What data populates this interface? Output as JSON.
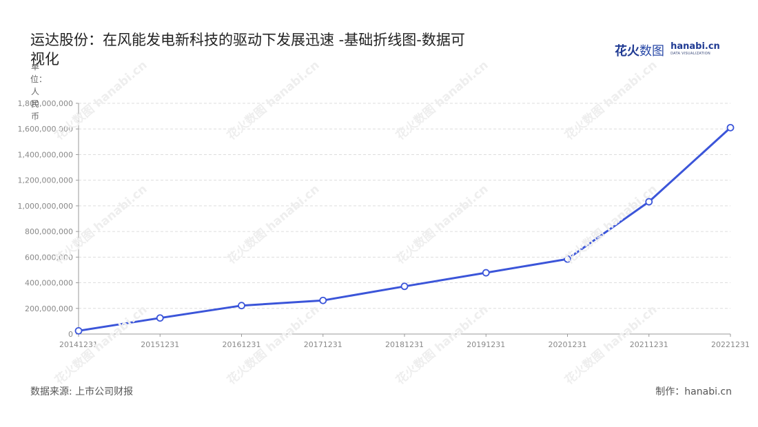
{
  "header": {
    "title_line1": "运达股份：在风能发电新科技的驱动下发展迅速  -基础折线图-数据可",
    "title_line2": "视化",
    "logo_cn_bold": "花火",
    "logo_cn_light": "数图",
    "logo_en": "hanabi.cn",
    "logo_sub": "DATA VISUALIZATION"
  },
  "yaxis_unit": "单位：人民币",
  "footer": {
    "source": "数据来源: 上市公司财报",
    "credit": "制作：hanabi.cn"
  },
  "colors": {
    "line": "#3b55d9",
    "marker_fill": "#ffffff",
    "grid": "#dddddd",
    "axis": "#999999",
    "tick_text": "#888888"
  },
  "chart_data": {
    "type": "line",
    "categories": [
      "20141231",
      "20151231",
      "20161231",
      "20171231",
      "20181231",
      "20191231",
      "20201231",
      "20211231",
      "20221231"
    ],
    "series": [
      {
        "values": [
          25000000,
          125000000,
          222000000,
          262000000,
          372000000,
          478000000,
          585000000,
          1032000000,
          1610000000
        ]
      }
    ],
    "ylim": [
      0,
      1800000000
    ],
    "yticks": [
      0,
      200000000,
      400000000,
      600000000,
      800000000,
      1000000000,
      1200000000,
      1400000000,
      1600000000,
      1800000000
    ],
    "ytick_labels": [
      "0",
      "200,000,000",
      "400,000,000",
      "600,000,000",
      "800,000,000",
      "1,000,000,000",
      "1,200,000,000",
      "1,400,000,000",
      "1,600,000,000",
      "1,800,000,000"
    ],
    "grid": true,
    "legend": "none"
  }
}
